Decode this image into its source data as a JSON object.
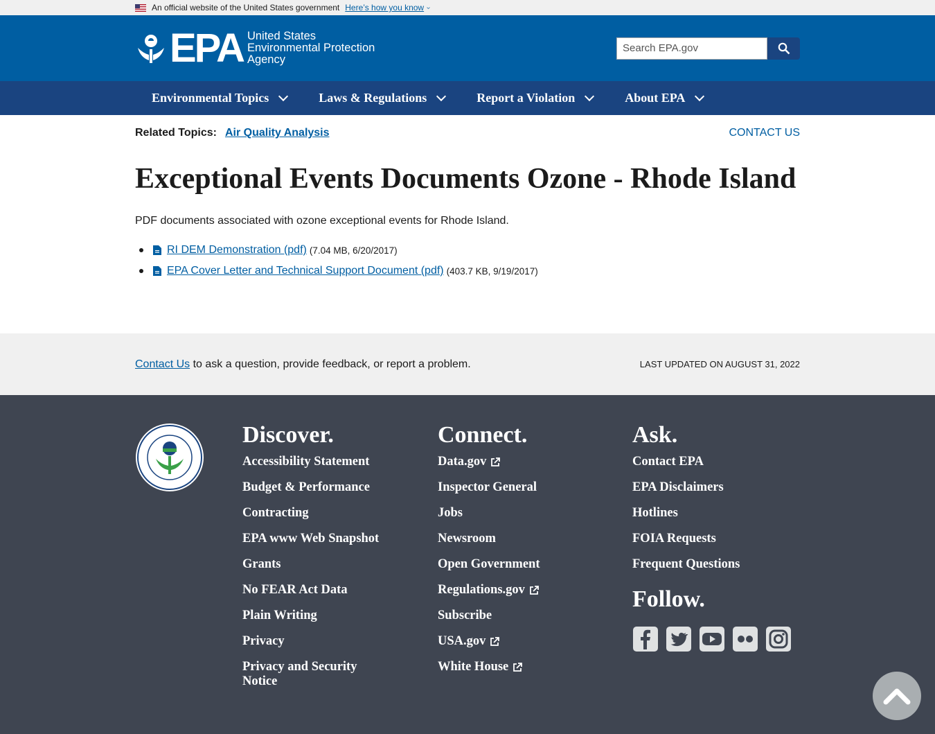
{
  "gov_banner": {
    "official_text": "An official website of the United States government",
    "how_link": "Here’s how you know"
  },
  "header": {
    "logo_text": "EPA",
    "agency_line1": "United States",
    "agency_line2": "Environmental Protection",
    "agency_line3": "Agency",
    "search_placeholder": "Search EPA.gov"
  },
  "nav": {
    "items": [
      {
        "label": "Environmental Topics"
      },
      {
        "label": "Laws & Regulations"
      },
      {
        "label": "Report a Violation"
      },
      {
        "label": "About EPA"
      }
    ]
  },
  "related": {
    "label": "Related Topics:",
    "link": "Air Quality Analysis",
    "contact": "CONTACT US"
  },
  "main": {
    "title": "Exceptional Events Documents Ozone - Rhode Island",
    "intro": "PDF documents associated with ozone exceptional events for Rhode Island.",
    "documents": [
      {
        "label": "RI DEM Demonstration (pdf)",
        "meta": "(7.04 MB, 6/20/2017)"
      },
      {
        "label": "EPA Cover Letter and Technical Support Document (pdf)",
        "meta": "(403.7 KB, 9/19/2017)"
      }
    ]
  },
  "contact_strip": {
    "link": "Contact Us",
    "text": " to ask a question, provide feedback, or report a problem.",
    "updated": "Last updated on August 31, 2022"
  },
  "footer": {
    "discover": {
      "heading": "Discover.",
      "items": [
        "Accessibility Statement",
        "Budget & Performance",
        "Contracting",
        "EPA www Web Snapshot",
        "Grants",
        "No FEAR Act Data",
        "Plain Writing",
        "Privacy",
        "Privacy and Security Notice"
      ]
    },
    "connect": {
      "heading": "Connect.",
      "items": [
        "Data.gov",
        "Inspector General",
        "Jobs",
        "Newsroom",
        "Open Government",
        "Regulations.gov",
        "Subscribe",
        "USA.gov",
        "White House"
      ]
    },
    "ask": {
      "heading": "Ask.",
      "items": [
        "Contact EPA",
        "EPA Disclaimers",
        "Hotlines",
        "FOIA Requests",
        "Frequent Questions"
      ]
    },
    "follow": {
      "heading": "Follow.",
      "icons": [
        "facebook-icon",
        "twitter-icon",
        "youtube-icon",
        "flickr-icon",
        "instagram-icon"
      ]
    }
  },
  "colors": {
    "header_blue": "#005ea2",
    "nav_blue": "#1a4480",
    "footer_gray": "#3f4551",
    "link_blue": "#005ea2"
  }
}
